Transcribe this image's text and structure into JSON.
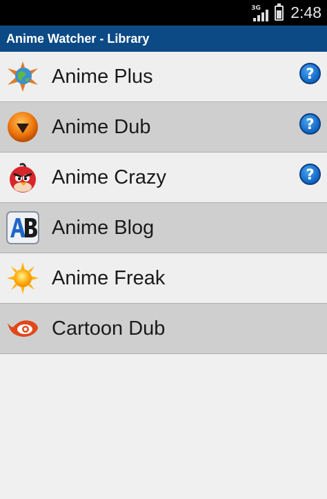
{
  "status_bar": {
    "network": "3G",
    "time": "2:48"
  },
  "app": {
    "title": "Anime Watcher - Library"
  },
  "library": {
    "items": [
      {
        "label": "Anime Plus",
        "icon": "globe-star-icon",
        "help": "?"
      },
      {
        "label": "Anime Dub",
        "icon": "orange-play-icon",
        "help": "?"
      },
      {
        "label": "Anime Crazy",
        "icon": "red-bird-icon",
        "help": "?"
      },
      {
        "label": "Anime Blog",
        "icon": "ab-letters-icon"
      },
      {
        "label": "Anime Freak",
        "icon": "sun-icon"
      },
      {
        "label": "Cartoon Dub",
        "icon": "red-eye-icon"
      }
    ]
  }
}
